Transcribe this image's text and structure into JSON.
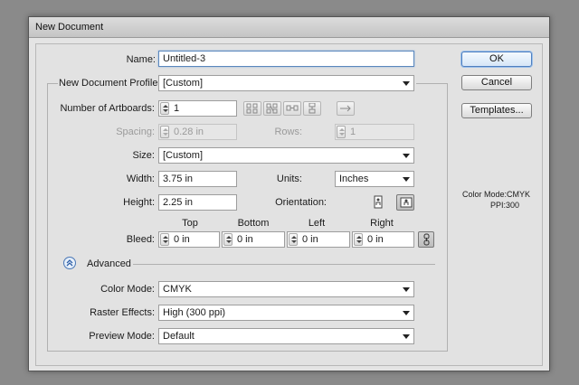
{
  "window": {
    "title": "New Document"
  },
  "form": {
    "name_label": "Name:",
    "name_value": "Untitled-3",
    "profile_label": "New Document Profile:",
    "profile_value": "[Custom]",
    "artboards_label": "Number of Artboards:",
    "artboards_value": "1",
    "spacing_label": "Spacing:",
    "spacing_value": "0.28 in",
    "rows_label": "Rows:",
    "rows_value": "1",
    "size_label": "Size:",
    "size_value": "[Custom]",
    "width_label": "Width:",
    "width_value": "3.75 in",
    "units_label": "Units:",
    "units_value": "Inches",
    "height_label": "Height:",
    "height_value": "2.25 in",
    "orientation_label": "Orientation:",
    "bleed_label": "Bleed:",
    "bleed_headers": {
      "top": "Top",
      "bottom": "Bottom",
      "left": "Left",
      "right": "Right"
    },
    "bleed_values": {
      "top": "0 in",
      "bottom": "0 in",
      "left": "0 in",
      "right": "0 in"
    },
    "advanced_label": "Advanced",
    "color_mode_label": "Color Mode:",
    "color_mode_value": "CMYK",
    "raster_label": "Raster Effects:",
    "raster_value": "High (300 ppi)",
    "preview_label": "Preview Mode:",
    "preview_value": "Default"
  },
  "buttons": {
    "ok": "OK",
    "cancel": "Cancel",
    "templates": "Templates..."
  },
  "info": {
    "color_mode": "Color Mode:CMYK",
    "ppi": "PPI:300"
  },
  "colors": {
    "dialog_bg": "#e4e4e4",
    "focus": "#5a87bd",
    "backdrop": "#8a8a8a"
  },
  "icons": [
    "grid-by-row-icon",
    "grid-by-column-icon",
    "arrange-by-row-icon",
    "arrange-by-column-icon",
    "layout-direction-arrow-icon",
    "portrait-icon",
    "landscape-icon",
    "link-bleed-icon",
    "collapse-advanced-icon"
  ]
}
